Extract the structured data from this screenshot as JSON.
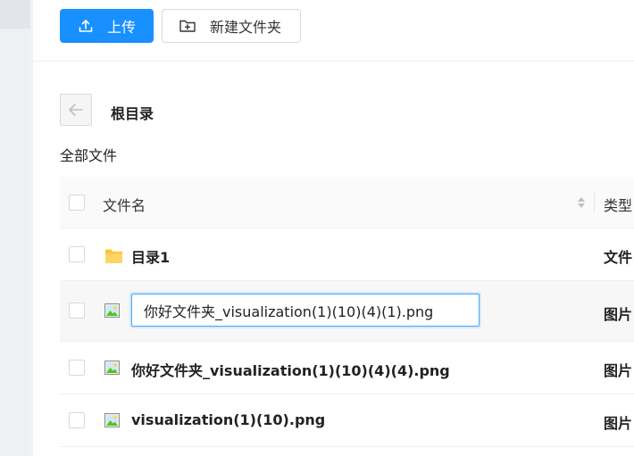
{
  "toolbar": {
    "upload_label": "上传",
    "new_folder_label": "新建文件夹"
  },
  "breadcrumb": {
    "current": "根目录"
  },
  "section_title": "全部文件",
  "table": {
    "columns": [
      "文件名",
      "类型"
    ],
    "rows": [
      {
        "name": "目录1",
        "type": "文件",
        "icon": "folder-icon"
      },
      {
        "name": "你好文件夹_visualization(1)(10)(4)(1).png",
        "type": "图片",
        "icon": "image-icon",
        "editing": true
      },
      {
        "name": "你好文件夹_visualization(1)(10)(4)(4).png",
        "type": "图片",
        "icon": "image-icon"
      },
      {
        "name": "visualization(1)(10).png",
        "type": "图片",
        "icon": "image-icon"
      }
    ]
  },
  "colors": {
    "primary": "#1890ff",
    "folder": "#ffc53d",
    "input_border": "#40a9ff"
  }
}
